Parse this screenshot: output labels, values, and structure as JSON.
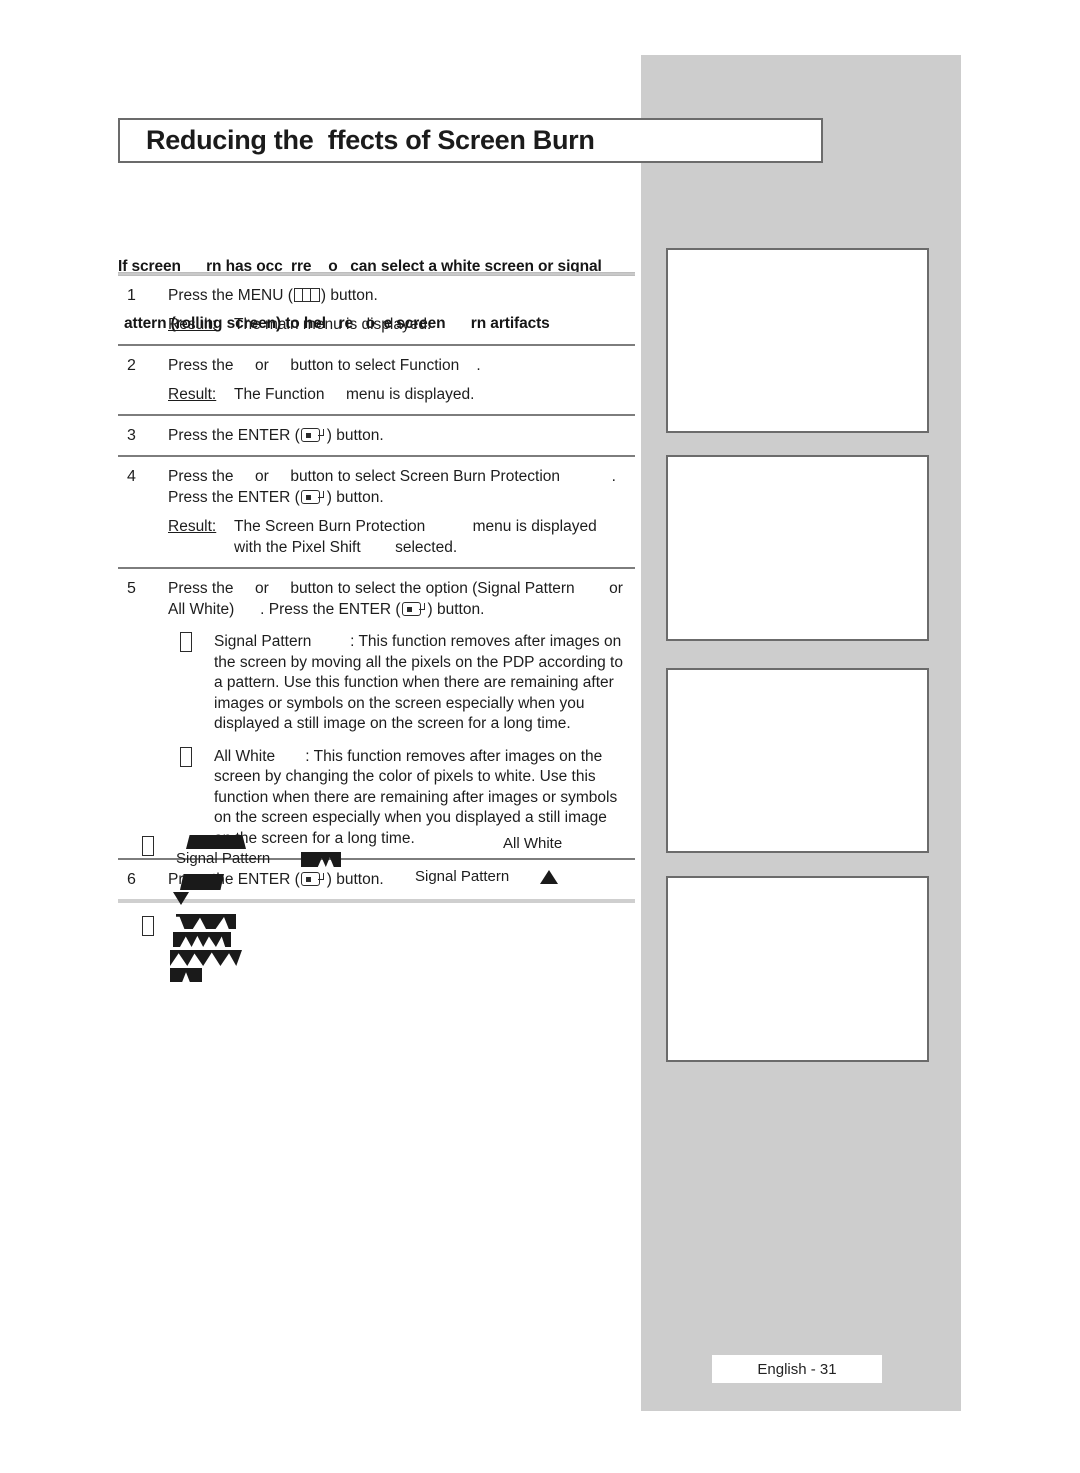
{
  "page": {
    "title": "Reducing the  ffects of Screen Burn",
    "footer": "English - 31"
  },
  "intro": {
    "line1": "If screen      rn has occ  rre    o   can select a white screen or signal",
    "line2": "attern (rolling screen) to hel   re   o  e screen      rn artifacts"
  },
  "steps": [
    {
      "num": "1",
      "lines": [
        "Press the MENU (",
        ") button."
      ],
      "icon": "menu-icon",
      "result_label": "Result:",
      "result_text": "The main menu is displayed."
    },
    {
      "num": "2",
      "lines": [
        "Press the     or     button to select Function    ."
      ],
      "result_label": "Result:",
      "result_text": "The Function     menu is displayed."
    },
    {
      "num": "3",
      "lines": [
        "Press the ENTER (",
        ") button."
      ],
      "icon": "enter-icon"
    },
    {
      "num": "4",
      "line_a": "Press the     or     button to select Screen Burn Protection            .",
      "line_b_pre": "Press the ENTER (",
      "line_b_post": ") button.",
      "result_label": "Result:",
      "result_text": "The Screen Burn Protection           menu is displayed",
      "result_text2": "with the Pixel Shift        selected."
    },
    {
      "num": "5",
      "line_a": "Press the     or     button to select the option (Signal Pattern        or",
      "line_b_pre": "All White)      . Press the ENTER (",
      "line_b_post": ") button.",
      "bullets": [
        {
          "lines": [
            "Signal Pattern         : This function removes after images on",
            "the screen by moving all the pixels on the PDP according to",
            "a pattern. Use this function when there are remaining after",
            "images or symbols on the screen especially when you",
            "displayed a still image on the screen for a long time."
          ]
        },
        {
          "lines": [
            "All White       : This function removes after images on the",
            "screen by changing the color of pixels to white. Use this",
            "function when there are remaining after images or symbols",
            "on the screen especially when you displayed a still image",
            "on the screen for a long time."
          ]
        }
      ]
    },
    {
      "num": "6",
      "lines": [
        "Press the ENTER (",
        ") button."
      ],
      "icon": "enter-icon"
    }
  ],
  "notes": {
    "note1_label": "Signal Pattern",
    "note1_right_top": "All White",
    "note1_right_label": "Signal Pattern"
  },
  "colors": {
    "panel_gray": "#cdcdcd",
    "box_border": "#6b6b6b",
    "rule_dark": "#7d7d7d",
    "rule_light": "#cfcfcf",
    "text": "#1d1d1d"
  }
}
